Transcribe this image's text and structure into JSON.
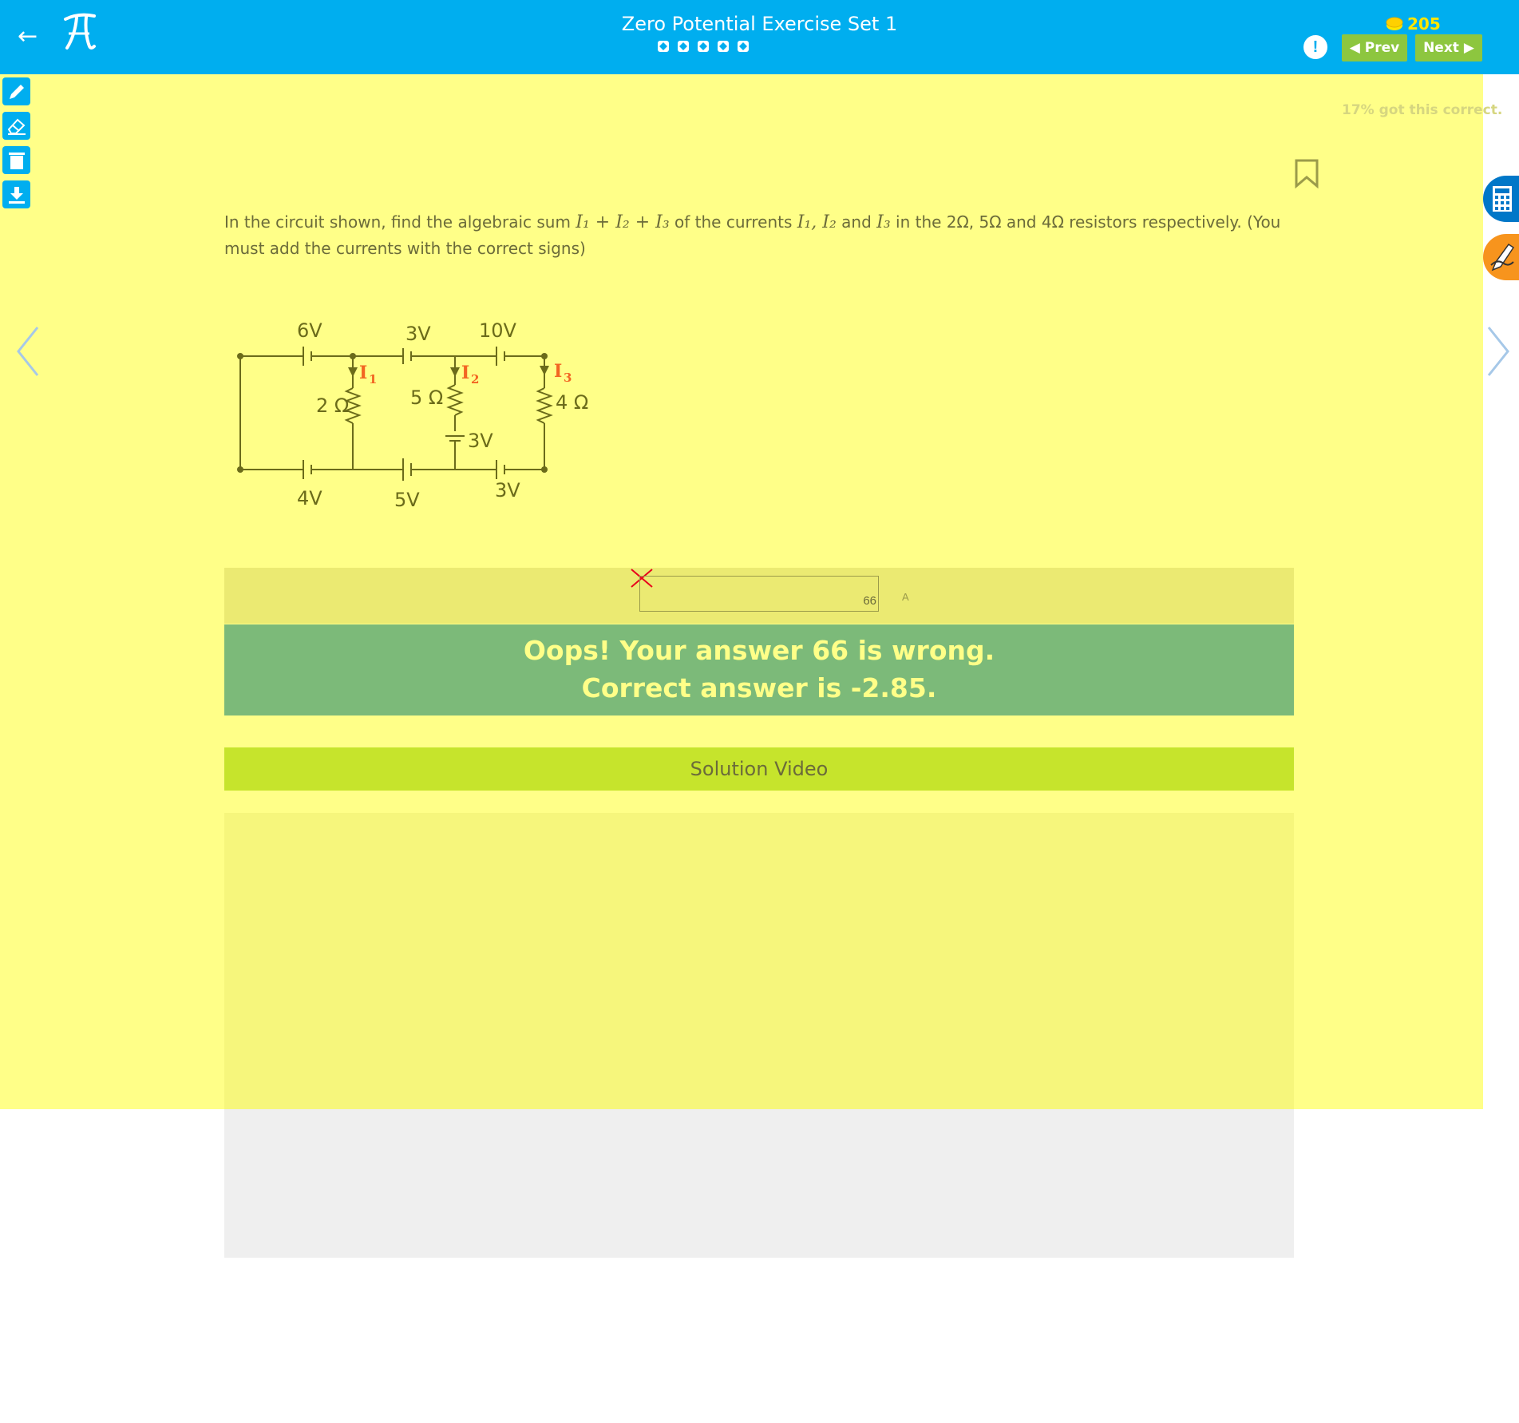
{
  "header": {
    "back_icon": "arrow-left-icon",
    "logo_icon": "pi-logo-icon",
    "title": "Zero Potential Exercise Set 1",
    "progress_dots": 5,
    "coins": "205",
    "alert_label": "!",
    "prev_label": "Prev",
    "next_label": "Next",
    "color_primary": "#00aeef",
    "color_nav": "#8dc63f"
  },
  "tools": [
    "pencil-icon",
    "eraser-icon",
    "trash-icon",
    "download-icon"
  ],
  "stats": {
    "percent_correct": "17% got this correct."
  },
  "question": {
    "text_part1": "In the circuit shown, find the algebraic sum ",
    "sum_expr": "I₁ + I₂ + I₃",
    "text_part2": " of the currents ",
    "currents": "I₁, I₂",
    "and": " and ",
    "i3": "I₃",
    "text_part3": " in the 2Ω, 5Ω and 4Ω resistors respectively. (You must add the currents  with the correct signs)"
  },
  "circuit": {
    "labels": {
      "v_top_left": "6V",
      "v_top_mid": "3V",
      "v_top_right": "10V",
      "v_bottom_left": "4V",
      "v_bottom_mid": "5V",
      "v_bottom_right": "3V",
      "v_branch": "3V",
      "r1": "2 Ω",
      "r2": "5 Ω",
      "r3": "4 Ω",
      "i1": "I",
      "i1_sub": "1",
      "i2": "I",
      "i2_sub": "2",
      "i3": "I",
      "i3_sub": "3"
    }
  },
  "answer": {
    "value": "66",
    "unit": "A",
    "status_icon": "wrong-x-icon"
  },
  "feedback": {
    "line1": "Oops! Your answer 66 is wrong.",
    "line2": "Correct answer is -2.85."
  },
  "solution": {
    "label": "Solution Video"
  },
  "side_buttons": [
    "calculator-icon",
    "pen-hand-icon"
  ]
}
